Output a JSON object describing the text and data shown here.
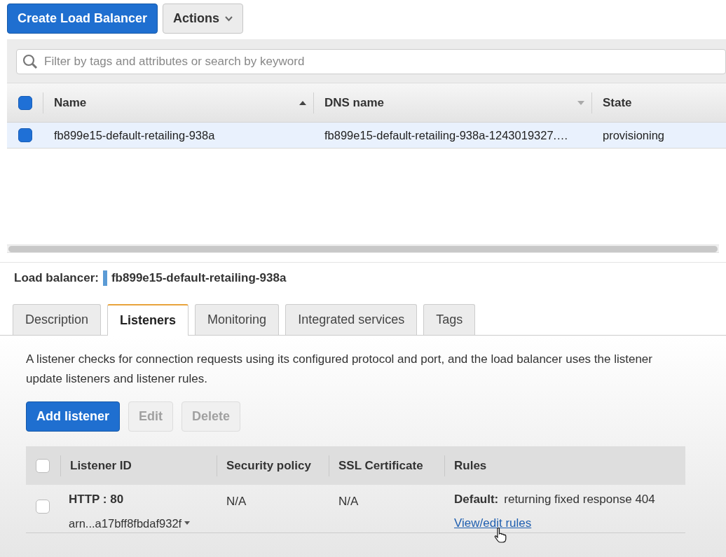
{
  "toolbar": {
    "buttons": [
      {
        "label": "Create Load Balancer",
        "kind": "primary"
      },
      {
        "label": "Actions",
        "kind": "dropdown"
      }
    ]
  },
  "search": {
    "placeholder": "Filter by tags and attributes or search by keyword"
  },
  "table": {
    "select_all_checked": true,
    "columns": [
      {
        "label": "Name",
        "sorted": true
      },
      {
        "label": "DNS name",
        "sorted": false
      },
      {
        "label": "State"
      }
    ],
    "rows": [
      {
        "selected": true,
        "checked": true,
        "cells": [
          "fb899e15-default-retailing-938a",
          "fb899e15-default-retailing-938a-1243019327.…",
          "provisioning"
        ]
      }
    ]
  },
  "details": {
    "label": "Load balancer:",
    "name": "fb899e15-default-retailing-938a"
  },
  "tabs": [
    {
      "label": "Description",
      "selected": false
    },
    {
      "label": "Listeners",
      "selected": true
    },
    {
      "label": "Monitoring",
      "selected": false
    },
    {
      "label": "Integrated services",
      "selected": false
    },
    {
      "label": "Tags",
      "selected": false
    }
  ],
  "listeners_panel": {
    "description_lines": [
      "A listener checks for connection requests using its configured protocol and port, and the load balancer uses the listener",
      "update listeners and listener rules."
    ],
    "buttons": [
      {
        "label": "Add listener",
        "disabled": false
      },
      {
        "label": "Edit",
        "disabled": true
      },
      {
        "label": "Delete",
        "disabled": true
      }
    ],
    "table": {
      "select_all_checked": false,
      "columns": [
        "Listener ID",
        "Security policy",
        "SSL Certificate",
        "Rules"
      ],
      "rows": [
        {
          "checked": false,
          "listener": "HTTP : 80",
          "arn": "arn...a17bff8fbdaf932f",
          "security_policy": "N/A",
          "ssl_certificate": "N/A",
          "rule_label": "Default:",
          "rule_text": "returning fixed response 404",
          "link": "View/edit rules"
        }
      ]
    }
  }
}
